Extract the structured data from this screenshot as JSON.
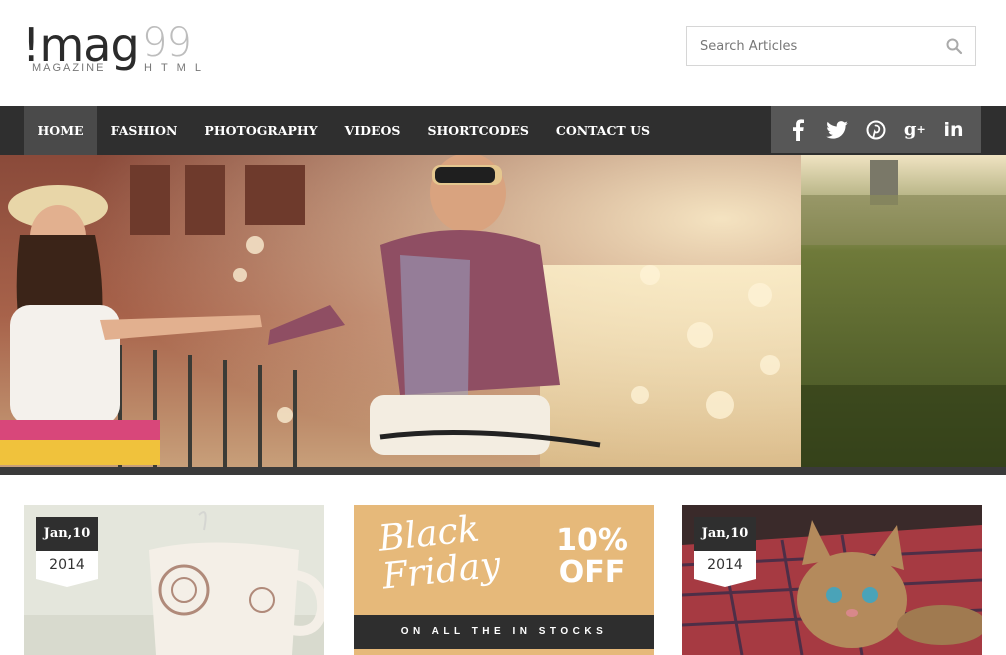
{
  "logo": {
    "main": "!mag",
    "numerals": "99",
    "sub_left": "MAGAZINE",
    "sub_right": "HTML"
  },
  "search": {
    "placeholder": "Search Articles"
  },
  "nav": {
    "items": [
      "HOME",
      "FASHION",
      "PHOTOGRAPHY",
      "VIDEOS",
      "SHORTCODES",
      "CONTACT US"
    ],
    "active": "HOME"
  },
  "social": {
    "icons": [
      "facebook-icon",
      "twitter-icon",
      "pinterest-icon",
      "google-plus-icon",
      "linkedin-icon"
    ],
    "glyphs": [
      "f",
      "t",
      "p",
      "g+",
      "in"
    ]
  },
  "cards": [
    {
      "date_top": "Jan,10",
      "date_bottom": "2014"
    },
    {
      "promo_left": "Black Friday",
      "promo_right": "10% OFF",
      "promo_band": "ON ALL THE IN STOCKS"
    },
    {
      "date_top": "Jan,10",
      "date_bottom": "2014"
    }
  ],
  "colors": {
    "nav_bg": "#2f2f2f",
    "nav_active": "#4a4a4a",
    "social_bg": "#575757",
    "promo_bg": "#e6b97a"
  }
}
